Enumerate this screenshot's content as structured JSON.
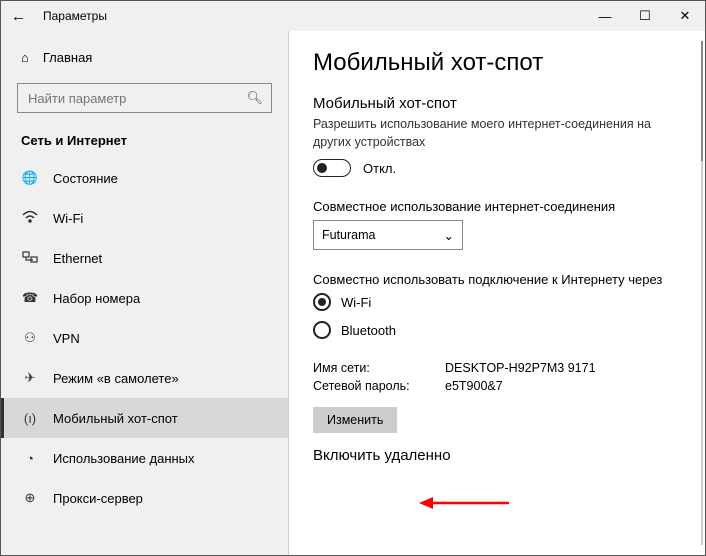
{
  "window": {
    "title": "Параметры"
  },
  "sidebar": {
    "home": "Главная",
    "search_placeholder": "Найти параметр",
    "category": "Сеть и Интернет",
    "items": [
      {
        "label": "Состояние"
      },
      {
        "label": "Wi-Fi"
      },
      {
        "label": "Ethernet"
      },
      {
        "label": "Набор номера"
      },
      {
        "label": "VPN"
      },
      {
        "label": "Режим «в самолете»"
      },
      {
        "label": "Мобильный хот-спот"
      },
      {
        "label": "Использование данных"
      },
      {
        "label": "Прокси-сервер"
      }
    ]
  },
  "content": {
    "page_title": "Мобильный хот-спот",
    "toggle_header": "Мобильный хот-спот",
    "toggle_desc": "Разрешить использование моего интернет-соединения на других устройствах",
    "toggle_state": "Откл.",
    "share_label": "Совместное использование интернет-соединения",
    "share_value": "Futurama",
    "share_via_label": "Совместно использовать подключение к Интернету через",
    "radio_wifi": "Wi-Fi",
    "radio_bt": "Bluetooth",
    "net_name_label": "Имя сети:",
    "net_name_value": "DESKTOP-H92P7M3 9171",
    "net_pass_label": "Сетевой пароль:",
    "net_pass_value": "e5T900&7",
    "edit_button": "Изменить",
    "remote_header": "Включить удаленно"
  }
}
